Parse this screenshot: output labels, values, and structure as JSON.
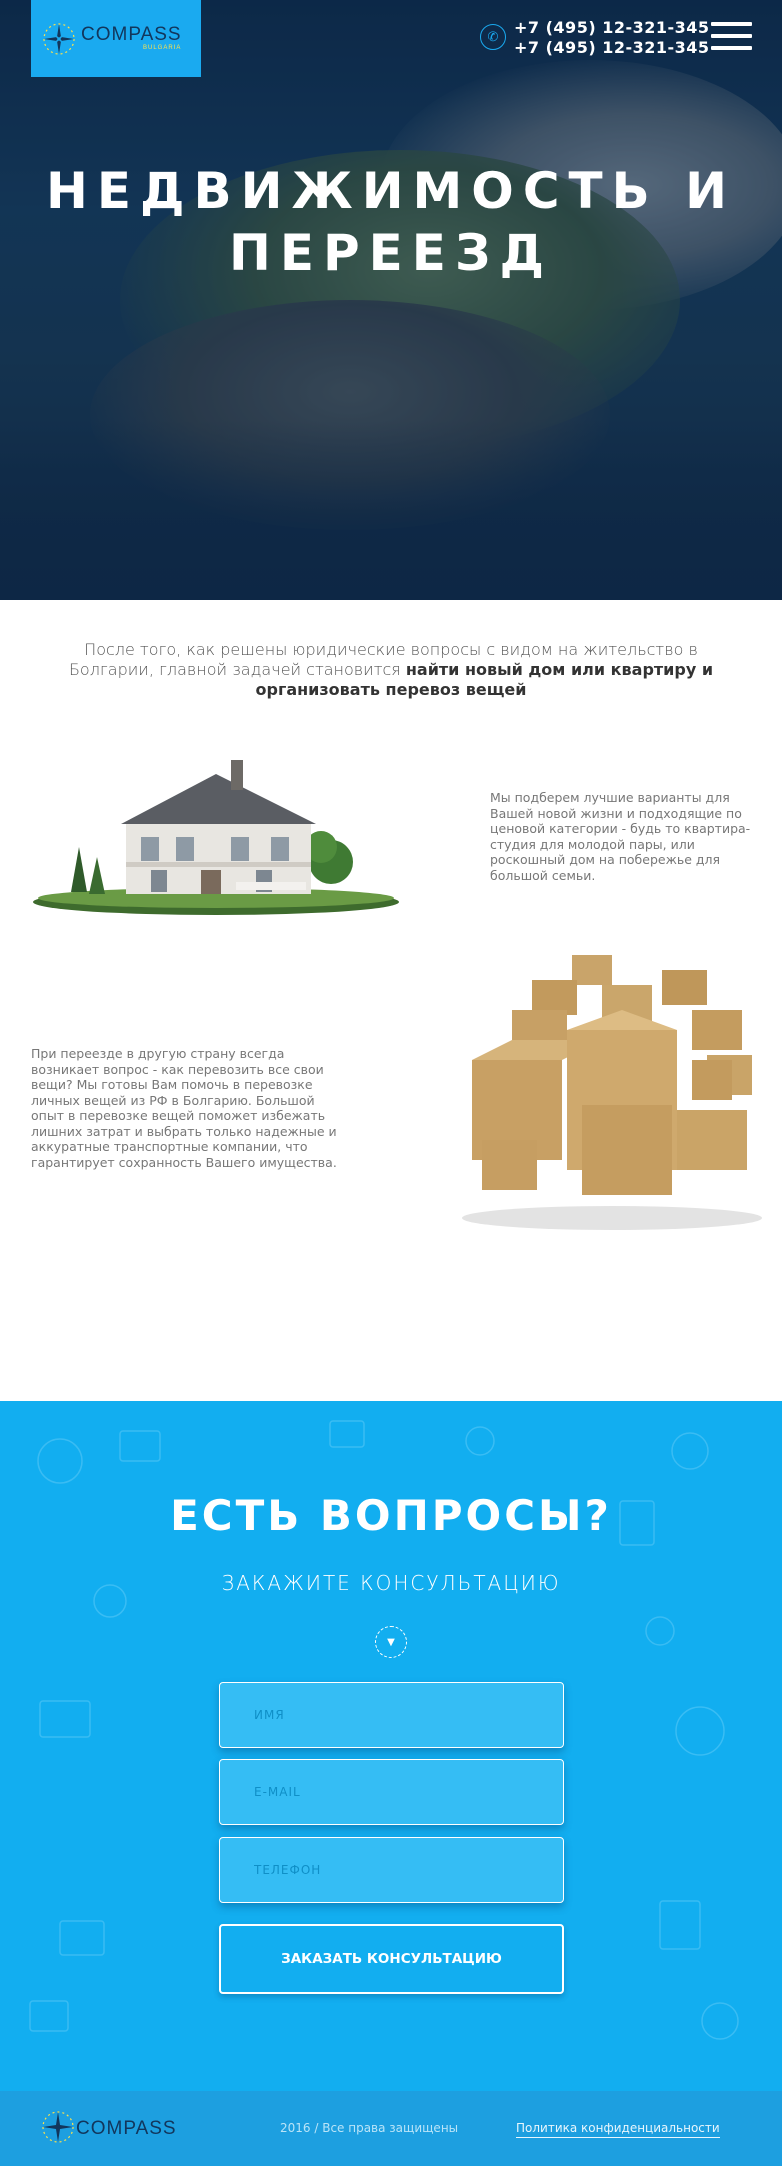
{
  "header": {
    "logo_name": "COMPASS",
    "logo_sub": "BULGARIA",
    "phones": [
      "+7 (495) 12-321-345",
      "+7 (495) 12-321-345"
    ],
    "phone_icon": "phone-icon",
    "menu_icon": "menu-icon"
  },
  "hero": {
    "title_line1": "НЕДВИЖИМОСТЬ И",
    "title_line2": "ПЕРЕЕЗД"
  },
  "intro": {
    "text_plain": "После того, как решены юридические вопросы с видом на жительство в Болгарии, главной задачей становится ",
    "text_bold": "найти новый дом или квартиру и организовать перевоз вещей"
  },
  "blocks": {
    "house_text": "Мы подберем лучшие варианты для Вашей новой жизни и подходящие по ценовой категории - будь то квартира-студия для молодой пары, или роскошный дом на побережье для большой семьи.",
    "moving_text": "При переезде в другую страну всегда возникает вопрос - как перевозить все свои вещи? Мы готовы Вам помочь в перевозке личных вещей из РФ в Болгарию. Большой опыт в перевозке вещей поможет избежать лишних затрат и выбрать только надежные и аккуратные транспортные компании, что гарантирует сохранность Вашего имущества."
  },
  "contact": {
    "title": "ЕСТЬ ВОПРОСЫ?",
    "subtitle": "ЗАКАЖИТЕ КОНСУЛЬТАЦИЮ",
    "name_placeholder": "ИМЯ",
    "email_placeholder": "E-MAIL",
    "phone_placeholder": "ТЕЛЕФОН",
    "submit_label": "ЗАКАЗАТЬ КОНСУЛЬТАЦИЮ"
  },
  "footer": {
    "logo_name": "COMPASS",
    "copyright": "2016 / Все права защищены",
    "policy_link": "Политика конфиденциальности"
  },
  "colors": {
    "accent": "#12aef0",
    "logo_bg": "#1aaaf0",
    "footer_bg": "#1d9fe0"
  }
}
